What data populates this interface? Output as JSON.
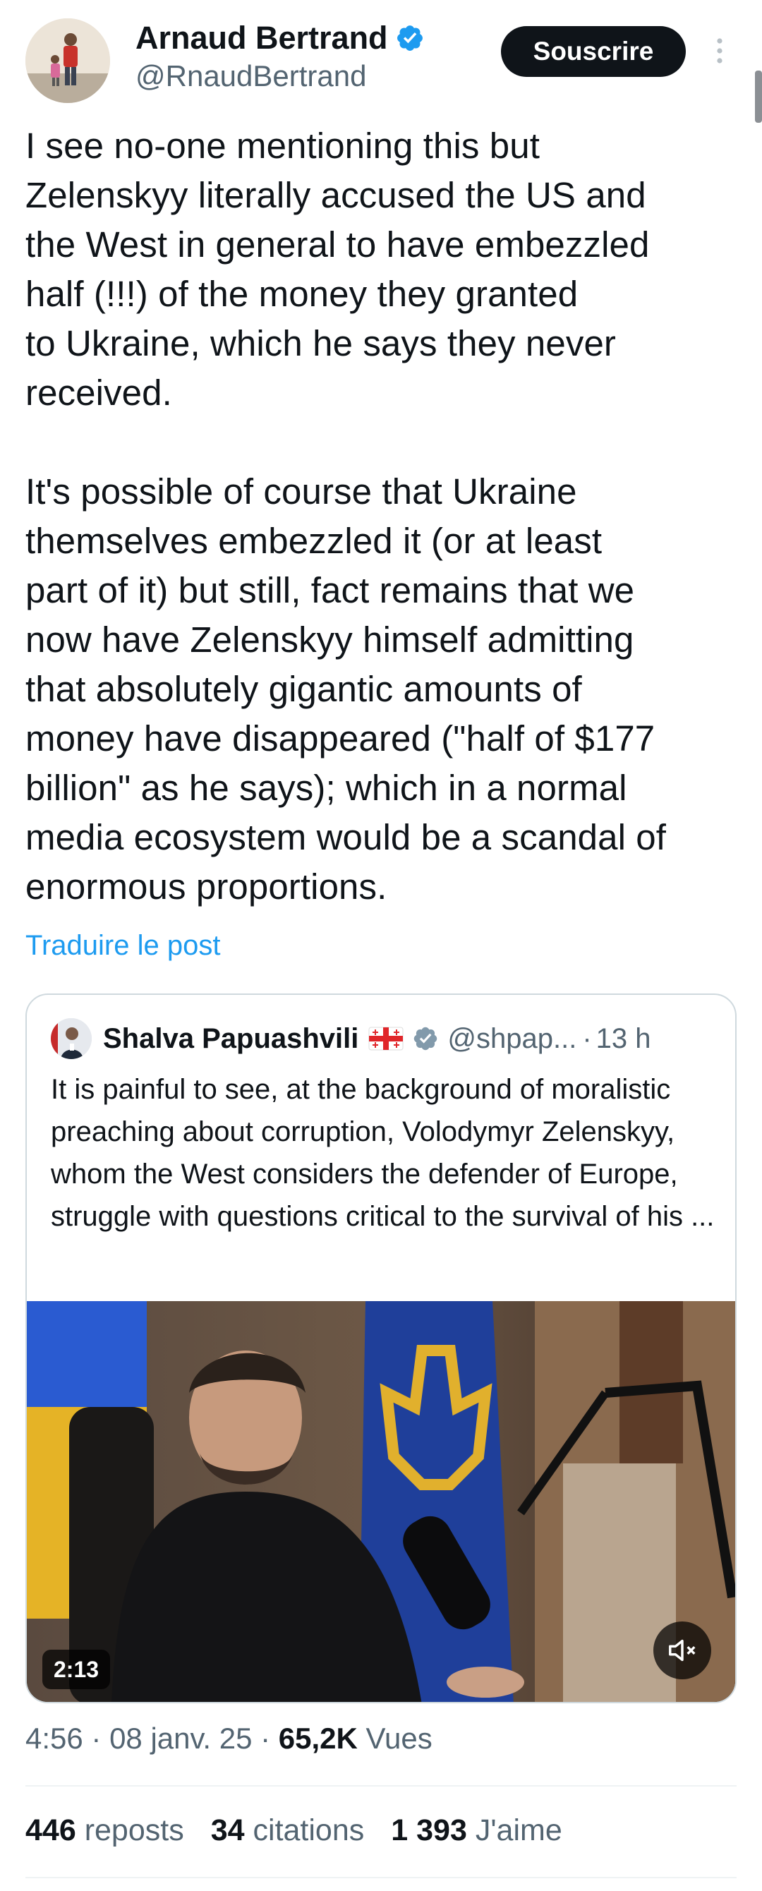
{
  "author": {
    "name": "Arnaud Bertrand",
    "handle": "@RnaudBertrand",
    "subscribe_label": "Souscrire"
  },
  "tweet": {
    "text": "I see no-one mentioning this but\nZelenskyy literally accused the US and\nthe West in general to have embezzled\nhalf (!!!) of the money they granted\nto Ukraine, which he says they never\nreceived.\n\nIt's possible of course that Ukraine\nthemselves embezzled it (or at least\npart of it) but still, fact remains that we\nnow have Zelenskyy himself admitting\nthat absolutely gigantic amounts of\nmoney have disappeared (\"half of $177\nbillion\" as he says); which in a normal\nmedia ecosystem would be a scandal of\nenormous proportions.",
    "translate_label": "Traduire le post"
  },
  "quote": {
    "name": "Shalva Papuashvili",
    "handle": "@shpap...",
    "separator": "·",
    "time": "13 h",
    "text": "It is painful to see, at the background of moralistic preaching about corruption, Volodymyr Zelenskyy, whom the West considers the defender of Europe, struggle with questions critical to the survival of his ...",
    "video_duration": "2:13"
  },
  "meta": {
    "time": "4:56",
    "sep1": " · ",
    "date": "08 janv. 25",
    "sep2": " · ",
    "views_count": "65,2K",
    "views_label": "Vues"
  },
  "stats": {
    "reposts_count": "446",
    "reposts_label": "reposts",
    "quotes_count": "34",
    "quotes_label": "citations",
    "likes_count": "1 393",
    "likes_label": "J'aime"
  },
  "colors": {
    "text": "#0f1419",
    "secondary": "#536471",
    "link": "#1d9bf0",
    "verified": "#1d9bf0",
    "border": "#cfd9de"
  },
  "icons": {
    "verified": "verified-badge-icon",
    "more": "more-vertical-icon",
    "mute": "muted-speaker-icon",
    "flag": "georgia-flag-icon"
  }
}
